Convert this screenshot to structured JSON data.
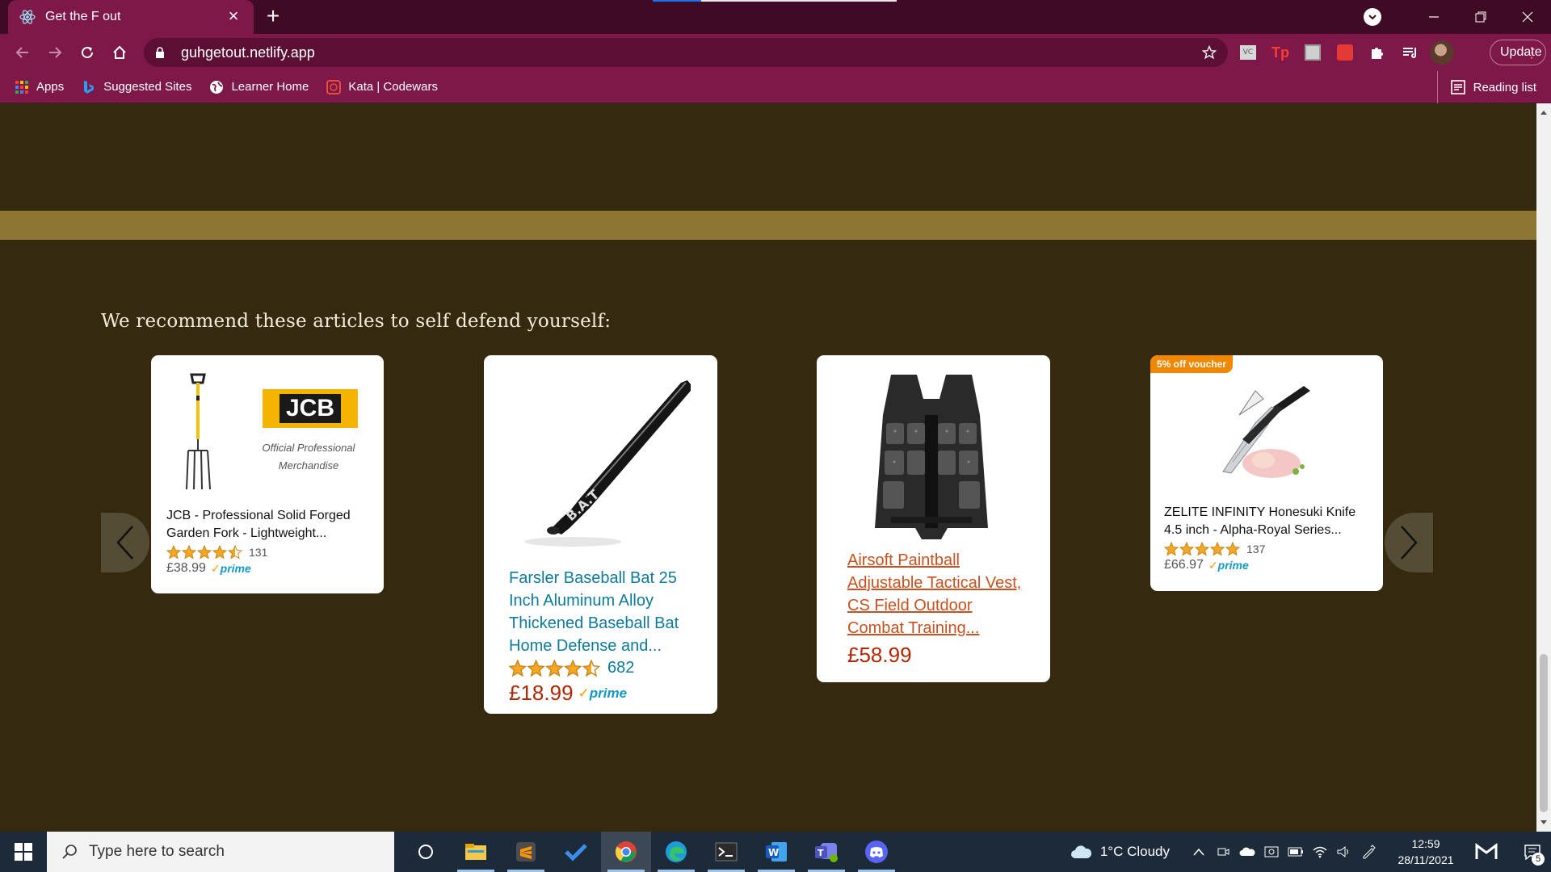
{
  "browser": {
    "tab_title": "Get the F out",
    "url": "guhgetout.netlify.app",
    "update_label": "Update",
    "bookmarks": [
      {
        "label": "Apps",
        "icon": "apps-grid-icon"
      },
      {
        "label": "Suggested Sites",
        "icon": "bing-icon"
      },
      {
        "label": "Learner Home",
        "icon": "globe-icon"
      },
      {
        "label": "Kata | Codewars",
        "icon": "codewars-icon"
      }
    ],
    "reading_list_label": "Reading list",
    "accent_color": "#7d1849"
  },
  "page": {
    "section_title": "We recommend these articles to self defend yourself:",
    "background_color": "#352a10",
    "band_color": "#8d7533",
    "products": [
      {
        "title_line1": "JCB - Professional Solid Forged",
        "title_line2": "Garden Fork - Lightweight...",
        "rating_count": "131",
        "rating": 4.5,
        "price": "£38.99",
        "prime": "prime",
        "brand_logo": "JCB",
        "brand_caption_line1": "Official Professional",
        "brand_caption_line2": "Merchandise"
      },
      {
        "title_line1": "Farsler Baseball Bat 25",
        "title_line2": "Inch Aluminum Alloy",
        "title_line3": "Thickened Baseball Bat",
        "title_line4": "Home Defense and...",
        "rating_count": "682",
        "rating": 4.5,
        "price": "£18.99",
        "prime": "prime",
        "bat_text": "B.A.T"
      },
      {
        "title_line1": "Airsoft Paintball",
        "title_line2": "Adjustable Tactical Vest,",
        "title_line3": "CS Field Outdoor",
        "title_line4": "Combat Training...",
        "price": "£58.99"
      },
      {
        "badge": "5% off voucher",
        "title_line1": "ZELITE INFINITY Honesuki Knife",
        "title_line2": "4.5 inch - Alpha-Royal Series...",
        "rating_count": "137",
        "rating": 5,
        "price": "£66.97",
        "prime": "prime"
      }
    ]
  },
  "taskbar": {
    "search_placeholder": "Type here to search",
    "weather": "1°C  Cloudy",
    "time": "12:59",
    "date": "28/11/2021",
    "notification_count": "5"
  }
}
